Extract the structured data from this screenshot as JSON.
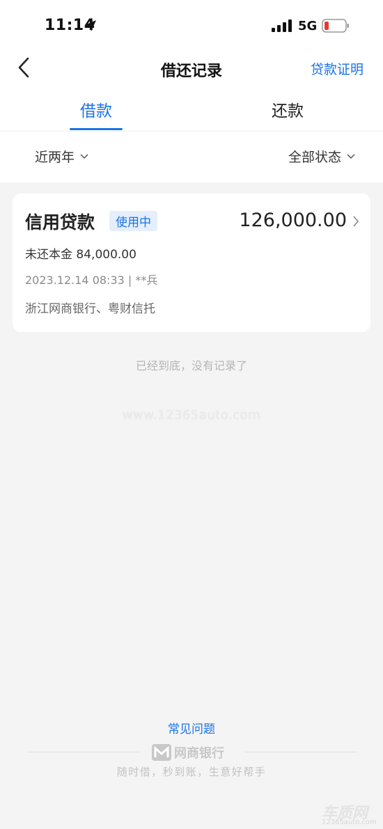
{
  "status_bar": {
    "time": "11:14",
    "network": "5G",
    "icons": [
      "location-arrow-icon",
      "signal-icon",
      "battery-low-icon"
    ],
    "battery_color": "#e53935"
  },
  "nav": {
    "title": "借还记录",
    "back_icon": "chevron-left-icon",
    "right_action": "贷款证明"
  },
  "tabs": [
    {
      "label": "借款",
      "active": true
    },
    {
      "label": "还款",
      "active": false
    }
  ],
  "filters": {
    "period": "近两年",
    "status": "全部状态"
  },
  "loans": [
    {
      "name": "信用贷款",
      "status": "使用中",
      "amount": "126,000.00",
      "principal": "未还本金 84,000.00",
      "date_line": "2023.12.14 08:33 | **兵",
      "banks": "浙江网商银行、粤财信托"
    }
  ],
  "end_text": "已经到底，没有记录了",
  "watermark": "www.12365auto.com",
  "footer": {
    "faq": "常见问题",
    "brand": "网商银行",
    "slogan": "随时借，秒到账，生意好帮手"
  },
  "corner_watermark": {
    "logo": "车质网",
    "url": "12365auto.com"
  },
  "colors": {
    "accent": "#1a73e8",
    "badge_bg": "#e4eefc",
    "page_bg": "#f4f4f4"
  }
}
